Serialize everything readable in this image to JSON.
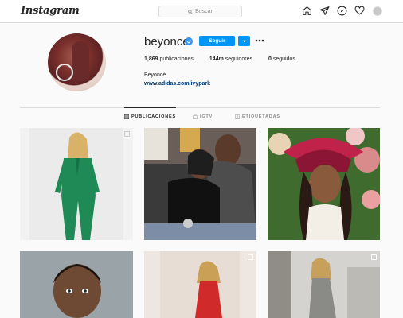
{
  "nav": {
    "logo": "Instagram",
    "search_placeholder": "Buscar",
    "icons": [
      "home-icon",
      "direct-icon",
      "explore-icon",
      "activity-icon",
      "profile-avatar"
    ]
  },
  "profile": {
    "username": "beyonce",
    "follow_label": "Seguir",
    "stats": {
      "posts_count": "1,869",
      "posts_label": "publicaciones",
      "followers_count": "144m",
      "followers_label": "seguidores",
      "following_count": "0",
      "following_label": "seguidos"
    },
    "full_name": "Beyoncé",
    "website": "www.adidas.com/ivypark"
  },
  "tabs": [
    {
      "label": "PUBLICACIONES",
      "icon": "grid-icon",
      "active": true
    },
    {
      "label": "IGTV",
      "icon": "igtv-icon",
      "active": false
    },
    {
      "label": "ETIQUETADAS",
      "icon": "tagged-icon",
      "active": false
    }
  ],
  "colors": {
    "accent": "#0095f6",
    "verified": "#3897f0",
    "link": "#00376b"
  }
}
